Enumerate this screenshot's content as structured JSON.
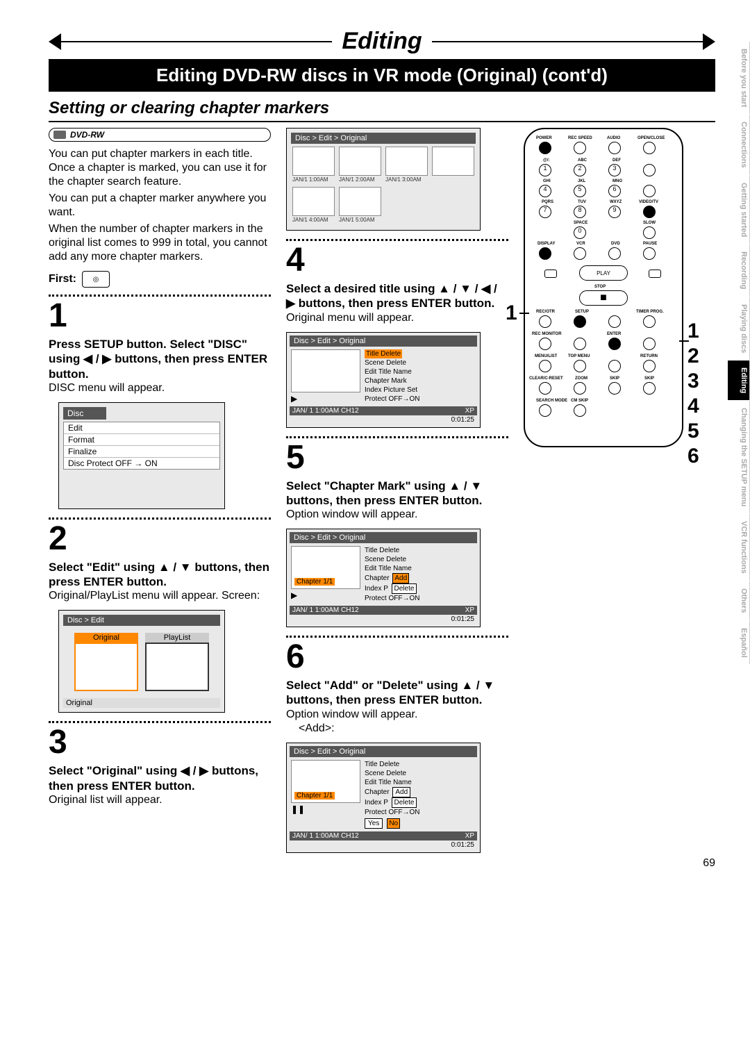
{
  "header_title": "Editing",
  "banner": "Editing DVD-RW discs in VR mode (Original) (cont'd)",
  "subtitle": "Setting or clearing chapter markers",
  "badge": "DVD-RW",
  "intro": {
    "p1": "You can put chapter markers in each title. Once a chapter is marked, you can use it for the chapter search feature.",
    "p2": "You can put a chapter marker anywhere you want.",
    "p3": "When the number of chapter markers in the original list comes to 999 in total, you cannot add any more chapter markers."
  },
  "first_label": "First:",
  "steps": {
    "s1": {
      "num": "1",
      "bold": "Press SETUP button. Select \"DISC\" using ◀ / ▶ buttons, then press ENTER button.",
      "note": "DISC menu will appear."
    },
    "s2": {
      "num": "2",
      "bold": "Select \"Edit\" using ▲ / ▼ buttons, then press ENTER button.",
      "note": "Original/PlayList menu will appear. Screen:"
    },
    "s3": {
      "num": "3",
      "bold": "Select \"Original\" using ◀ / ▶ buttons, then press ENTER button.",
      "note": "Original list will appear."
    },
    "s4": {
      "num": "4",
      "bold": "Select a desired title using ▲ / ▼ / ◀ / ▶ buttons, then press ENTER button.",
      "note": "Original menu will appear."
    },
    "s5": {
      "num": "5",
      "bold": "Select \"Chapter Mark\" using ▲ / ▼ buttons, then press ENTER button.",
      "note": "Option window will appear."
    },
    "s6": {
      "num": "6",
      "bold": "Select \"Add\" or \"Delete\" using ▲ / ▼ buttons, then press ENTER button.",
      "note": "Option window will appear.",
      "sub": "<Add>:"
    }
  },
  "disc_menu": {
    "header": "Disc",
    "items": [
      "Edit",
      "Format",
      "Finalize",
      "Disc Protect OFF → ON"
    ]
  },
  "op_screen": {
    "breadcrumb": "Disc > Edit",
    "opt1": "Original",
    "opt2": "PlayList",
    "footer": "Original"
  },
  "thumb_screen": {
    "breadcrumb": "Disc > Edit > Original",
    "caps": [
      "JAN/1  1:00AM",
      "JAN/1  2:00AM",
      "JAN/1  3:00AM",
      "JAN/1  4:00AM",
      "JAN/1  5:00AM"
    ]
  },
  "detail_common": {
    "breadcrumb": "Disc > Edit > Original",
    "menu": [
      "Title Delete",
      "Scene Delete",
      "Edit Title Name",
      "Chapter Mark",
      "Index Picture Set",
      "Protect OFF→ON"
    ],
    "footbar_left": "JAN/ 1   1:00AM  CH12",
    "footbar_right": "XP",
    "timecode": "0:01:25",
    "chapter_chip": "Chapter 1/1",
    "sub_add": "Add",
    "sub_del": "Delete",
    "yes": "Yes",
    "no": "No"
  },
  "remote": {
    "row_labels": [
      "POWER",
      "REC SPEED",
      "AUDIO",
      "OPEN/CLOSE"
    ],
    "keypad_labels": [
      "@/:",
      "ABC",
      "DEF",
      "GHI",
      "JKL",
      "MNO",
      "PQRS",
      "TUV",
      "WXYZ",
      "SPACE",
      "VIDEO/TV",
      "SLOW"
    ],
    "mid_labels": [
      "DISPLAY",
      "VCR",
      "DVD",
      "PAUSE"
    ],
    "play": "PLAY",
    "stop": "STOP",
    "row2": [
      "REC/OTR",
      "SETUP",
      "",
      "TIMER PROG."
    ],
    "row3": [
      "REC MONITOR",
      "",
      "ENTER",
      ""
    ],
    "row4": [
      "MENU/LIST",
      "TOP MENU",
      "",
      "RETURN"
    ],
    "row5": [
      "CLEAR/C-RESET",
      "ZOOM",
      "SKIP",
      "SKIP"
    ],
    "row6": [
      "SEARCH MODE",
      "CM SKIP"
    ],
    "side_nums": [
      "1",
      "2",
      "3",
      "4",
      "5",
      "6"
    ],
    "callout": "1"
  },
  "tabs": [
    "Before you start",
    "Connections",
    "Getting started",
    "Recording",
    "Playing discs",
    "Editing",
    "Changing the SETUP menu",
    "VCR functions",
    "Others",
    "Español"
  ],
  "active_tab": "Editing",
  "page_number": "69"
}
